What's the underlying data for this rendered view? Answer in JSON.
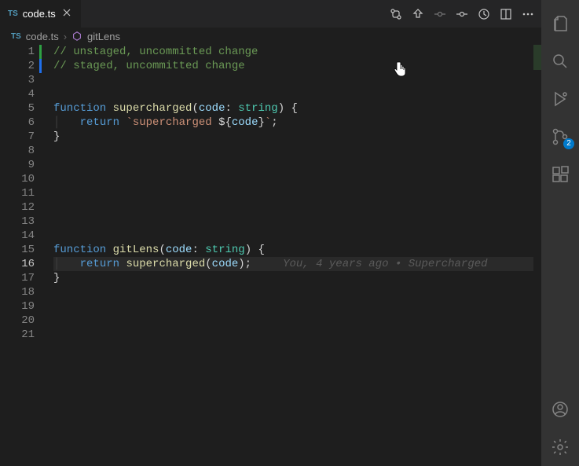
{
  "tab": {
    "filename": "code.ts",
    "lang": "TS"
  },
  "breadcrumbs": {
    "file": "code.ts",
    "symbol": "gitLens",
    "lang": "TS"
  },
  "badge": {
    "sourceControl": "2"
  },
  "blame": "You, 4 years ago • Supercharged",
  "lines": [
    {
      "n": 1,
      "mod": "unstaged",
      "tokens": [
        [
          "c",
          "// unstaged, uncommitted change"
        ]
      ]
    },
    {
      "n": 2,
      "mod": "staged",
      "tokens": [
        [
          "c",
          "// staged, uncommitted change"
        ]
      ]
    },
    {
      "n": 3,
      "tokens": []
    },
    {
      "n": 4,
      "tokens": []
    },
    {
      "n": 5,
      "tokens": [
        [
          "kw",
          "function "
        ],
        [
          "fn",
          "supercharged"
        ],
        [
          "pu",
          "("
        ],
        [
          "pr",
          "code"
        ],
        [
          "pu",
          ": "
        ],
        [
          "ty",
          "string"
        ],
        [
          "pu",
          ") {"
        ]
      ]
    },
    {
      "n": 6,
      "indent": 4,
      "guide": true,
      "tokens": [
        [
          "kw",
          "return "
        ],
        [
          "st",
          "`supercharged "
        ],
        [
          "pu",
          "${"
        ],
        [
          "tv",
          "code"
        ],
        [
          "pu",
          "}"
        ],
        [
          "st",
          "`"
        ],
        [
          "pu",
          ";"
        ]
      ]
    },
    {
      "n": 7,
      "tokens": [
        [
          "pu",
          "}"
        ]
      ]
    },
    {
      "n": 8,
      "tokens": []
    },
    {
      "n": 9,
      "tokens": []
    },
    {
      "n": 10,
      "tokens": []
    },
    {
      "n": 11,
      "tokens": []
    },
    {
      "n": 12,
      "tokens": []
    },
    {
      "n": 13,
      "tokens": []
    },
    {
      "n": 14,
      "tokens": []
    },
    {
      "n": 15,
      "tokens": [
        [
          "kw",
          "function "
        ],
        [
          "fn",
          "gitLens"
        ],
        [
          "pu",
          "("
        ],
        [
          "pr",
          "code"
        ],
        [
          "pu",
          ": "
        ],
        [
          "ty",
          "string"
        ],
        [
          "pu",
          ") {"
        ]
      ]
    },
    {
      "n": 16,
      "indent": 4,
      "guide": true,
      "current": true,
      "blame": true,
      "tokens": [
        [
          "kw",
          "return "
        ],
        [
          "fn",
          "supercharged"
        ],
        [
          "pu",
          "("
        ],
        [
          "pr",
          "code"
        ],
        [
          "pu",
          ");"
        ]
      ]
    },
    {
      "n": 17,
      "tokens": [
        [
          "pu",
          "}"
        ]
      ]
    },
    {
      "n": 18,
      "tokens": []
    },
    {
      "n": 19,
      "tokens": []
    },
    {
      "n": 20,
      "tokens": []
    },
    {
      "n": 21,
      "tokens": []
    }
  ]
}
